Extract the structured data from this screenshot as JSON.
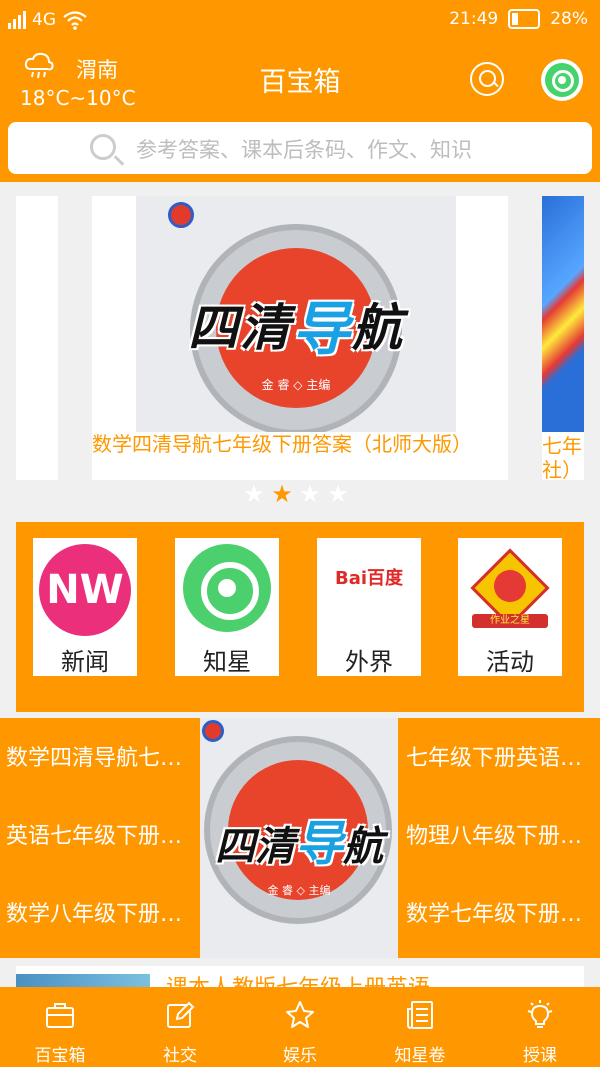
{
  "status_bar": {
    "network": "4G",
    "time": "21:49",
    "battery": "28%"
  },
  "header": {
    "city": "渭南",
    "temperature": "18°C~10°C",
    "title": "百宝箱",
    "weather_icon": "cloud-rain-icon"
  },
  "search": {
    "placeholder": "参考答案、课本后条码、作文、知识"
  },
  "carousel": {
    "book_title_part1": "四清",
    "book_title_highlight": "导",
    "book_title_part2": "航",
    "book_author": "金 睿 ◇ 主编",
    "main_caption": "数学四清导航七年级下册答案（北师大版）",
    "right_caption_line1": "七年",
    "right_caption_line2": "社）",
    "page_count": 4,
    "active_page": 2
  },
  "shortcuts": [
    {
      "label": "新闻",
      "icon_text": "NW"
    },
    {
      "label": "知星",
      "icon_text": ""
    },
    {
      "label": "外界",
      "icon_text": "Bai百度"
    },
    {
      "label": "活动",
      "icon_text": "作业之星"
    }
  ],
  "grid": {
    "left": [
      "数学四清导航七…",
      "英语七年级下册…",
      "数学八年级下册…"
    ],
    "right": [
      "七年级下册英语…",
      "物理八年级下册…",
      "数学七年级下册…"
    ],
    "center_title_part1": "四清",
    "center_title_highlight": "导",
    "center_title_part2": "航",
    "center_author": "金 睿 ◇ 主编"
  },
  "list": [
    {
      "title": "课本人教版七年级上册英语"
    }
  ],
  "tabbar": [
    {
      "label": "百宝箱",
      "icon": "briefcase-icon"
    },
    {
      "label": "社交",
      "icon": "edit-icon"
    },
    {
      "label": "娱乐",
      "icon": "star-icon"
    },
    {
      "label": "知星卷",
      "icon": "newspaper-icon"
    },
    {
      "label": "授课",
      "icon": "lightbulb-icon"
    }
  ],
  "colors": {
    "accent": "#ff9800",
    "background": "#f0f0f0"
  }
}
